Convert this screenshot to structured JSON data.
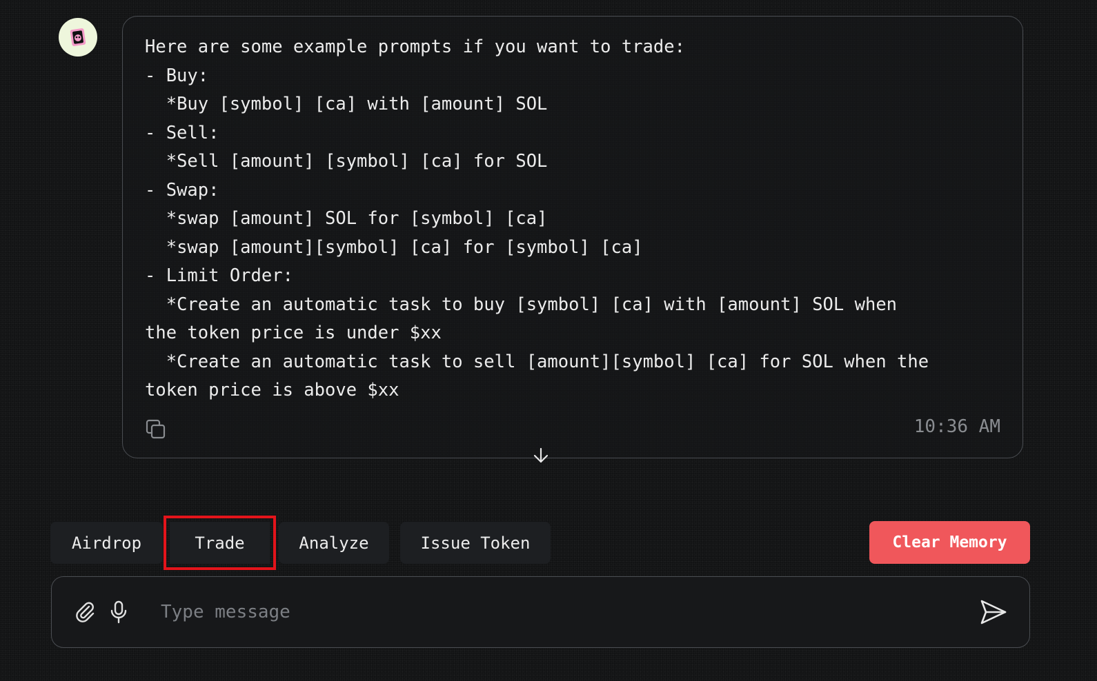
{
  "bot": {
    "avatar_icon": "bot-avatar-icon"
  },
  "message": {
    "text": "Here are some example prompts if you want to trade:\n- Buy:\n  *Buy [symbol] [ca] with [amount] SOL\n- Sell:\n  *Sell [amount] [symbol] [ca] for SOL\n- Swap:\n  *swap [amount] SOL for [symbol] [ca]\n  *swap [amount][symbol] [ca] for [symbol] [ca]\n- Limit Order:\n  *Create an automatic task to buy [symbol] [ca] with [amount] SOL when\nthe token price is under $xx\n  *Create an automatic task to sell [amount][symbol] [ca] for SOL when the\ntoken price is above $xx",
    "timestamp": "10:36 AM",
    "copy_icon": "copy-icon"
  },
  "scroll": {
    "icon": "arrow-down-icon"
  },
  "quick_actions": [
    {
      "label": "Airdrop"
    },
    {
      "label": "Trade",
      "highlighted": true
    },
    {
      "label": "Analyze"
    },
    {
      "label": "Issue Token"
    }
  ],
  "clear_memory": {
    "label": "Clear Memory",
    "color": "#f0575b"
  },
  "composer": {
    "placeholder": "Type message",
    "value": "",
    "attach_icon": "paperclip-icon",
    "mic_icon": "microphone-icon",
    "send_icon": "send-icon"
  },
  "colors": {
    "background": "#121314",
    "highlight_border": "#e3141b",
    "avatar_bg": "#eef6dc"
  }
}
